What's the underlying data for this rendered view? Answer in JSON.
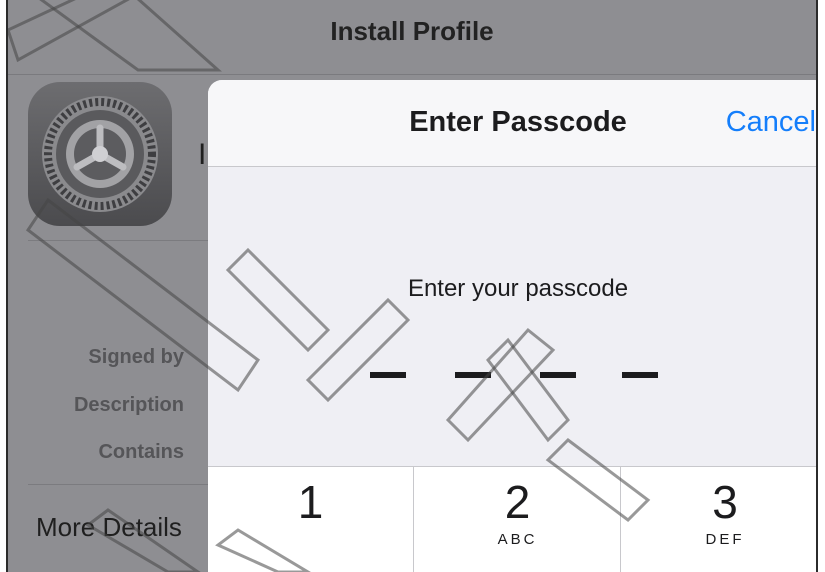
{
  "background": {
    "nav_title": "Install Profile",
    "partial_letter": "I",
    "labels": [
      "Signed by",
      "Description",
      "Contains"
    ],
    "more_details": "More Details"
  },
  "sheet": {
    "title": "Enter Passcode",
    "cancel_label": "Cancel",
    "prompt": "Enter your passcode",
    "entered_digits": 0,
    "passcode_length": 4
  },
  "keypad": [
    {
      "number": "1",
      "letters": ""
    },
    {
      "number": "2",
      "letters": "ABC"
    },
    {
      "number": "3",
      "letters": "DEF"
    }
  ],
  "watermark": {
    "text": "USE ONLY"
  },
  "colors": {
    "accent": "#147efb",
    "dimmed_background": "#8e8e92",
    "sheet_background": "#efeff4"
  }
}
